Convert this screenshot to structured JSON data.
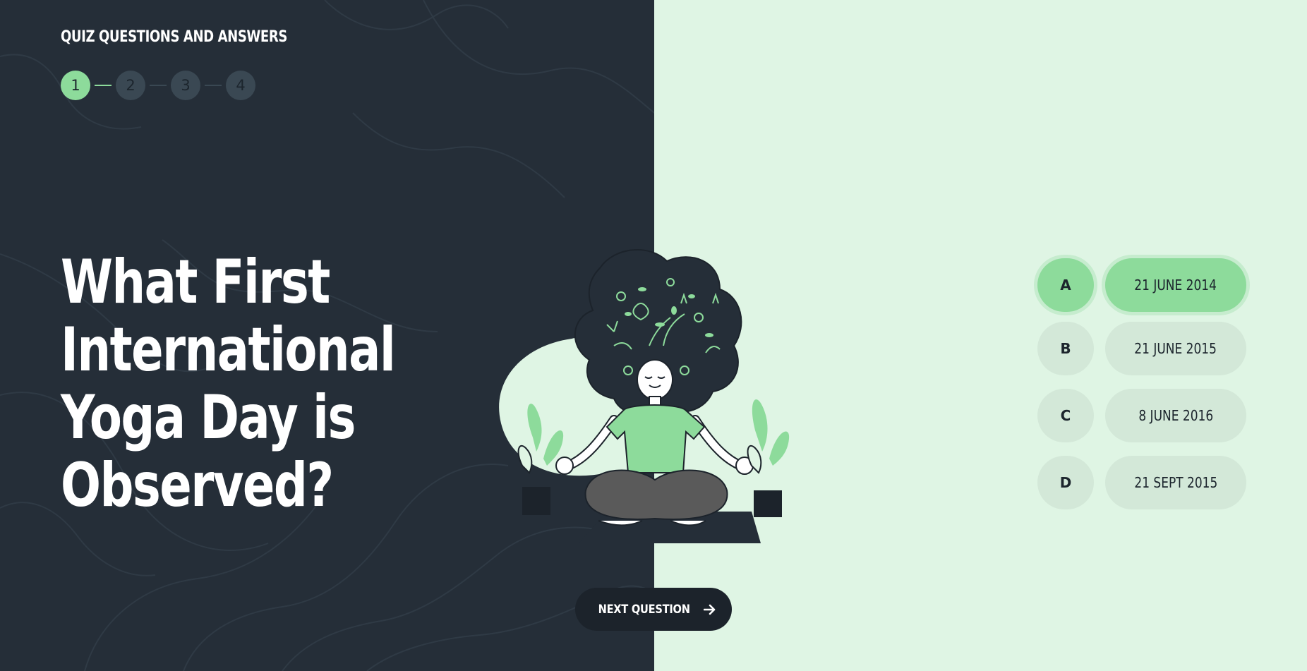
{
  "app": {
    "title": "QUIZ QUESTIONS AND ANSWERS"
  },
  "stepper": {
    "steps": [
      "1",
      "2",
      "3",
      "4"
    ],
    "current": 1
  },
  "question": {
    "lines": [
      "What First",
      "International",
      "Yoga Day is",
      "Observed?"
    ]
  },
  "answers": [
    {
      "letter": "A",
      "text": "21 JUNE 2014",
      "selected": true
    },
    {
      "letter": "B",
      "text": "21 JUNE 2015",
      "selected": false
    },
    {
      "letter": "C",
      "text": "8 JUNE 2016",
      "selected": false
    },
    {
      "letter": "D",
      "text": "21 SEPT 2015",
      "selected": false
    }
  ],
  "next_button": {
    "label": "NEXT QUESTION",
    "icon": "arrow-right-icon"
  },
  "colors": {
    "dark_panel": "#252e38",
    "light_panel": "#dff5e4",
    "accent": "#8ddb9b",
    "button": "#1c232b"
  }
}
